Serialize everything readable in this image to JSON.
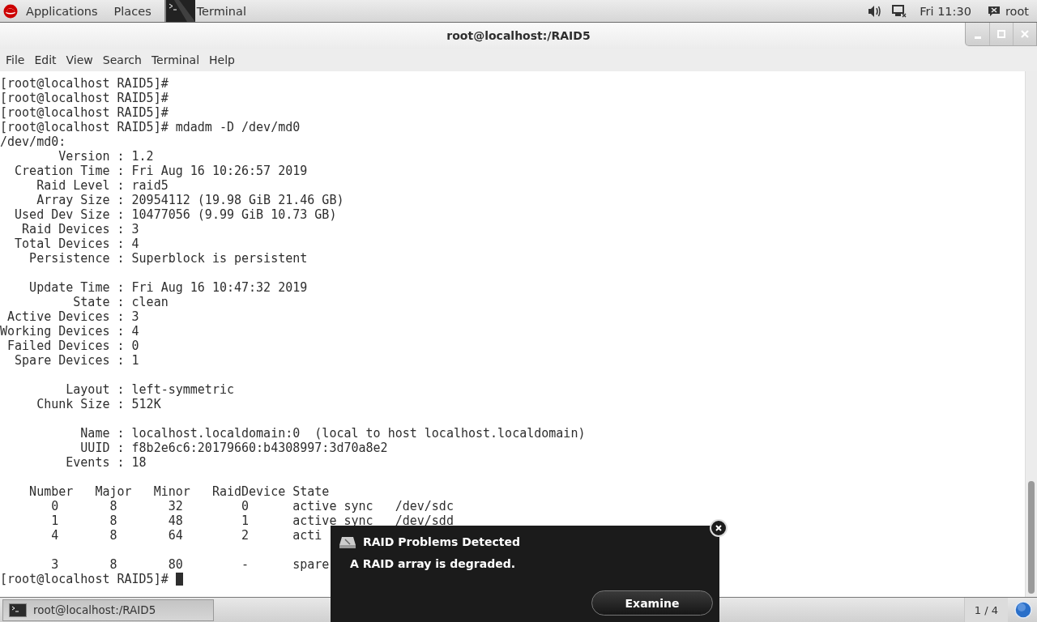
{
  "top_panel": {
    "applications": "Applications",
    "places": "Places",
    "task": "Terminal",
    "clock": "Fri 11:30",
    "user": "root"
  },
  "window": {
    "title": "root@localhost:/RAID5",
    "menu": [
      "File",
      "Edit",
      "View",
      "Search",
      "Terminal",
      "Help"
    ],
    "blocks": [
      [
        "[root@localhost RAID5]#",
        "[root@localhost RAID5]#",
        "[root@localhost RAID5]#",
        "[root@localhost RAID5]# mdadm -D /dev/md0",
        "/dev/md0:",
        "        Version : 1.2",
        "  Creation Time : Fri Aug 16 10:26:57 2019",
        "     Raid Level : raid5",
        "     Array Size : 20954112 (19.98 GiB 21.46 GB)",
        "  Used Dev Size : 10477056 (9.99 GiB 10.73 GB)",
        "   Raid Devices : 3",
        "  Total Devices : 4",
        "    Persistence : Superblock is persistent"
      ],
      [
        "    Update Time : Fri Aug 16 10:47:32 2019",
        "          State : clean",
        " Active Devices : 3",
        "Working Devices : 4",
        " Failed Devices : 0",
        "  Spare Devices : 1"
      ],
      [
        "         Layout : left-symmetric",
        "     Chunk Size : 512K"
      ],
      [
        "           Name : localhost.localdomain:0  (local to host localhost.localdomain)",
        "           UUID : f8b2e6c6:20179660:b4308997:3d70a8e2",
        "         Events : 18"
      ],
      [
        "    Number   Major   Minor   RaidDevice State",
        "       0       8       32        0      active sync   /dev/sdc",
        "       1       8       48        1      active sync   /dev/sdd",
        "       4       8       64        2      acti"
      ],
      [
        "       3       8       80        -      spare",
        "[root@localhost RAID5]# "
      ]
    ]
  },
  "notification": {
    "title": "RAID Problems Detected",
    "body": "A RAID array is degraded.",
    "button": "Examine"
  },
  "taskbar": {
    "items": [
      {
        "label": "root@localhost:/RAID5",
        "selected": true
      }
    ],
    "workspace": "1 / 4"
  }
}
